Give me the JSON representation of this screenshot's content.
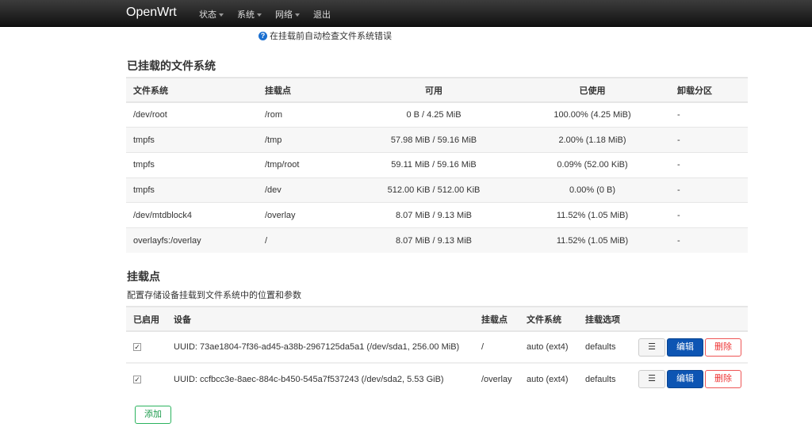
{
  "nav": {
    "brand": "OpenWrt",
    "menu": [
      "状态",
      "系统",
      "网络"
    ],
    "logout": "退出"
  },
  "hint": "在挂载前自动检查文件系统错误",
  "mounted": {
    "title": "已挂载的文件系统",
    "headers": [
      "文件系统",
      "挂载点",
      "可用",
      "已使用",
      "卸载分区"
    ],
    "rows": [
      [
        "/dev/root",
        "/rom",
        "0 B / 4.25 MiB",
        "100.00% (4.25 MiB)",
        "-"
      ],
      [
        "tmpfs",
        "/tmp",
        "57.98 MiB / 59.16 MiB",
        "2.00% (1.18 MiB)",
        "-"
      ],
      [
        "tmpfs",
        "/tmp/root",
        "59.11 MiB / 59.16 MiB",
        "0.09% (52.00 KiB)",
        "-"
      ],
      [
        "tmpfs",
        "/dev",
        "512.00 KiB / 512.00 KiB",
        "0.00% (0 B)",
        "-"
      ],
      [
        "/dev/mtdblock4",
        "/overlay",
        "8.07 MiB / 9.13 MiB",
        "11.52% (1.05 MiB)",
        "-"
      ],
      [
        "overlayfs:/overlay",
        "/",
        "8.07 MiB / 9.13 MiB",
        "11.52% (1.05 MiB)",
        "-"
      ]
    ]
  },
  "mounts": {
    "title": "挂载点",
    "desc": "配置存储设备挂载到文件系统中的位置和参数",
    "headers": [
      "已启用",
      "设备",
      "挂载点",
      "文件系统",
      "挂载选项"
    ],
    "rows": [
      {
        "enabled": "✓",
        "device": "UUID: 73ae1804-7f36-ad45-a38b-2967125da5a1 (/dev/sda1, 256.00 MiB)",
        "mount": "/",
        "fs": "auto (ext4)",
        "opts": "defaults"
      },
      {
        "enabled": "✓",
        "device": "UUID: ccfbcc3e-8aec-884c-b450-545a7f537243 (/dev/sda2, 5.53 GiB)",
        "mount": "/overlay",
        "fs": "auto (ext4)",
        "opts": "defaults"
      }
    ],
    "menu_btn": "☰",
    "edit": "编辑",
    "delete": "删除",
    "add": "添加"
  }
}
